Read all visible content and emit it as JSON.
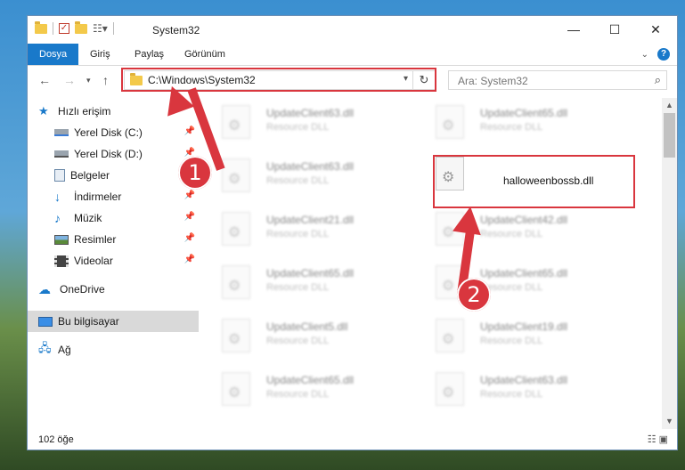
{
  "window": {
    "title": "System32",
    "controls": {
      "minimize": "—",
      "maximize": "☐",
      "close": "✕"
    }
  },
  "ribbon": {
    "tabs": [
      {
        "label": "Dosya",
        "active": true
      },
      {
        "label": "Giriş"
      },
      {
        "label": "Paylaş"
      },
      {
        "label": "Görünüm"
      }
    ]
  },
  "address": {
    "path": "C:\\Windows\\System32",
    "search_placeholder": "Ara: System32"
  },
  "nav": {
    "items": [
      {
        "label": "Hızlı erişim",
        "icon": "star-icon"
      },
      {
        "label": "Yerel Disk (C:)",
        "icon": "drive-icon",
        "pinned": true
      },
      {
        "label": "Yerel Disk (D:)",
        "icon": "drive-icon",
        "pinned": true
      },
      {
        "label": "Belgeler",
        "icon": "documents-icon",
        "pinned": true
      },
      {
        "label": "İndirmeler",
        "icon": "download-icon",
        "pinned": true
      },
      {
        "label": "Müzik",
        "icon": "music-icon",
        "pinned": true
      },
      {
        "label": "Resimler",
        "icon": "pictures-icon",
        "pinned": true
      },
      {
        "label": "Videolar",
        "icon": "videos-icon",
        "pinned": true
      },
      {
        "label": "OneDrive",
        "icon": "cloud-icon"
      },
      {
        "label": "Bu bilgisayar",
        "icon": "computer-icon",
        "selected": true
      },
      {
        "label": "Ağ",
        "icon": "network-icon"
      }
    ]
  },
  "files": {
    "type_label": "Resource DLL",
    "items": [
      {
        "name": "UpdateClient63.dll",
        "type": "Resource DLL"
      },
      {
        "name": "UpdateClient65.dll",
        "type": "Resource DLL"
      },
      {
        "name": "UpdateClient63.dll",
        "type": "Resource DLL"
      },
      {
        "name": "halloweenbossb.dll",
        "type": "",
        "highlight": true
      },
      {
        "name": "UpdateClient21.dll",
        "type": "Resource DLL"
      },
      {
        "name": "UpdateClient42.dll",
        "type": "Resource DLL"
      },
      {
        "name": "UpdateClient65.dll",
        "type": "Resource DLL"
      },
      {
        "name": "UpdateClient65.dll",
        "type": "Resource DLL"
      },
      {
        "name": "UpdateClient5.dll",
        "type": "Resource DLL"
      },
      {
        "name": "UpdateClient19.dll",
        "type": "Resource DLL"
      },
      {
        "name": "UpdateClient65.dll",
        "type": "Resource DLL"
      },
      {
        "name": "UpdateClient63.dll",
        "type": "Resource DLL"
      }
    ]
  },
  "status": {
    "count": "102 öğe"
  },
  "annotations": {
    "step1": "1",
    "step2": "2",
    "color": "#d9363e"
  }
}
